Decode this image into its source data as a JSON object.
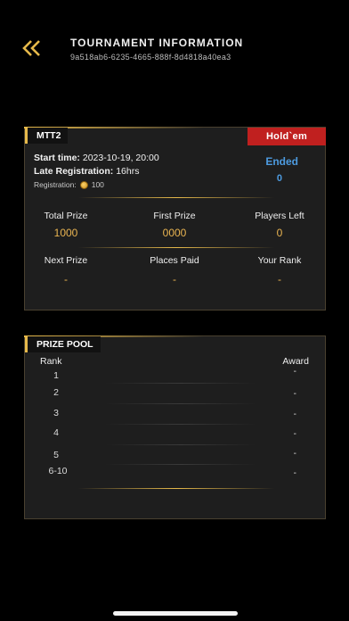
{
  "header": {
    "title": "TOURNAMENT INFORMATION",
    "tournament_id": "9a518ab6-6235-4665-888f-8d4818a40ea3",
    "back_icon": "double-chevron-left-icon"
  },
  "info_card": {
    "tournament_name": "MTT2",
    "game_type": "Hold`em",
    "start_time_label": "Start time:",
    "start_time_value": "2023-10-19, 20:00",
    "late_reg_label": "Late Registration:",
    "late_reg_value": "16hrs",
    "registration_label": "Registration:",
    "registration_fee": "100",
    "status": "Ended",
    "status_count": "0",
    "stats": [
      {
        "label": "Total Prize",
        "value": "1000"
      },
      {
        "label": "First Prize",
        "value": "0000"
      },
      {
        "label": "Players Left",
        "value": "0"
      },
      {
        "label": "Next Prize",
        "value": "-"
      },
      {
        "label": "Places Paid",
        "value": "-"
      },
      {
        "label": "Your Rank",
        "value": "-"
      }
    ]
  },
  "prize_pool": {
    "title": "PRIZE POOL",
    "rank_header": "Rank",
    "award_header": "Award",
    "rows": [
      {
        "rank": "1",
        "award": "-"
      },
      {
        "rank": "2",
        "award": "-"
      },
      {
        "rank": "3",
        "award": "-"
      },
      {
        "rank": "4",
        "award": "-"
      },
      {
        "rank": "5",
        "award": "-"
      },
      {
        "rank": "6-10",
        "award": "-"
      }
    ]
  },
  "colors": {
    "accent_gold": "#e6b94a",
    "badge_red": "#c0201f",
    "status_blue": "#4d9be0",
    "card_bg": "#1e1e1e"
  }
}
